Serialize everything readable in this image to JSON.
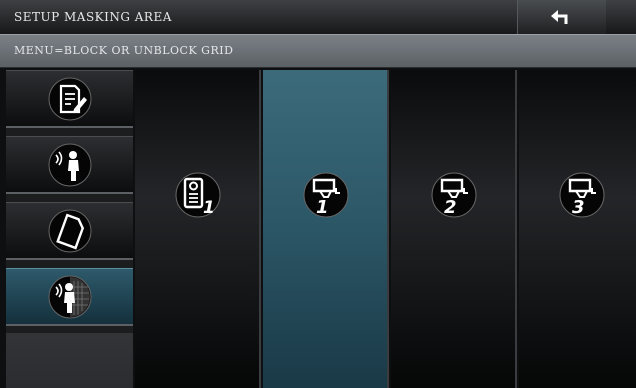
{
  "header": {
    "title": "SETUP MASKING AREA",
    "back_icon": "back-arrow-icon"
  },
  "subheader": {
    "instruction": "MENU=BLOCK OR UNBLOCK GRID"
  },
  "sidebar": {
    "items": [
      {
        "icon": "document-edit-icon",
        "active": false
      },
      {
        "icon": "motion-detection-icon",
        "active": false
      },
      {
        "icon": "sd-card-icon",
        "active": false
      },
      {
        "icon": "masking-area-icon",
        "active": true
      }
    ]
  },
  "grid": {
    "cells": [
      {
        "icon": "door-station-icon",
        "number": "1",
        "active": false
      },
      {
        "icon": "camera-icon",
        "number": "1",
        "active": true
      },
      {
        "icon": "camera-icon",
        "number": "2",
        "active": false
      },
      {
        "icon": "camera-icon",
        "number": "3",
        "active": false
      }
    ]
  },
  "colors": {
    "accent": "#2e5a6b",
    "background": "#0e0f10",
    "subbar": "#6b7075"
  }
}
